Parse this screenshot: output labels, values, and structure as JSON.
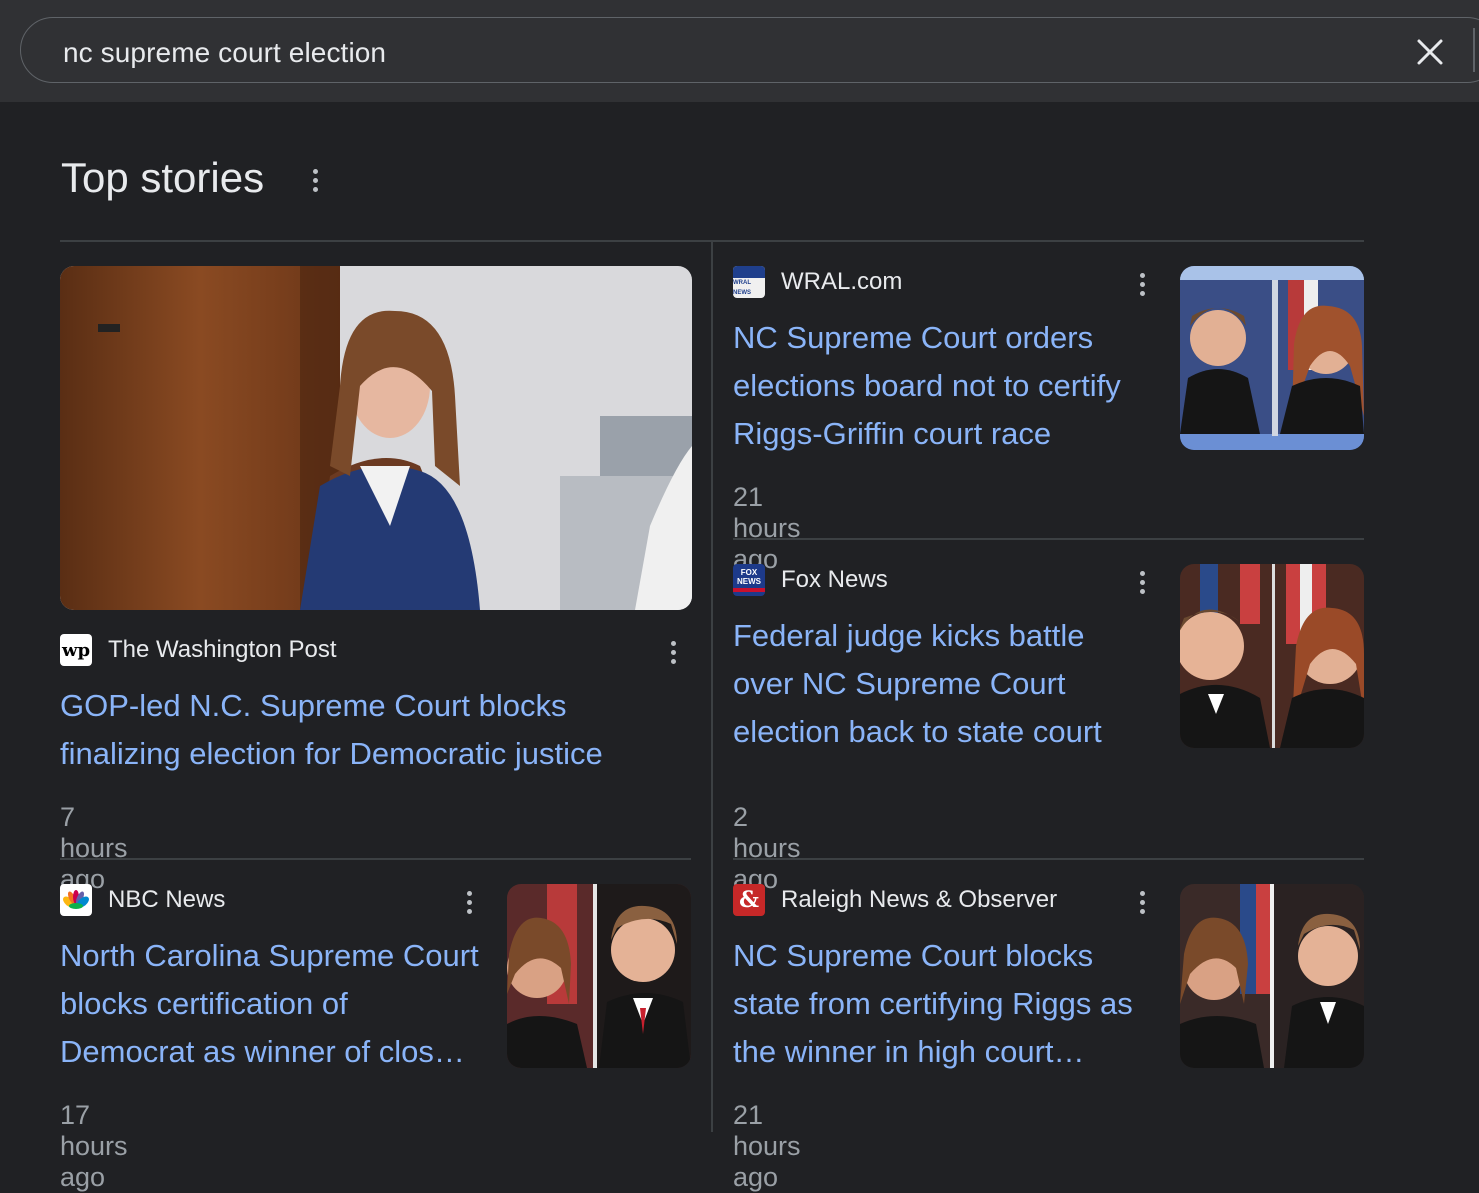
{
  "search": {
    "query": "nc supreme court election"
  },
  "section": {
    "title": "Top stories"
  },
  "stories": [
    {
      "source": "The Washington Post",
      "favicon_text": "wp",
      "headline": "GOP-led N.C. Supreme Court blocks finalizing election for Democratic justice",
      "time": "7 hours ago"
    },
    {
      "source": "WRAL.com",
      "favicon_text": "WRAL NEWS",
      "headline": "NC Supreme Court orders elections board not to certify Riggs-Griffin court race",
      "time": "21 hours ago"
    },
    {
      "source": "Fox News",
      "favicon_text": "FOX NEWS",
      "headline": "Federal judge kicks battle over NC Supreme Court election back to state court",
      "time": "2 hours ago"
    },
    {
      "source": "NBC News",
      "favicon_text": "",
      "headline": "North Carolina Supreme Court blocks certification of Democrat as winner of clos…",
      "time": "17 hours ago"
    },
    {
      "source": "Raleigh News & Observer",
      "favicon_text": "&",
      "headline": "NC Supreme Court blocks state from certifying Riggs as the winner in high court…",
      "time": "21 hours ago"
    }
  ],
  "colors": {
    "background": "#202124",
    "link": "#8ab4f8",
    "muted": "#9aa0a6"
  }
}
